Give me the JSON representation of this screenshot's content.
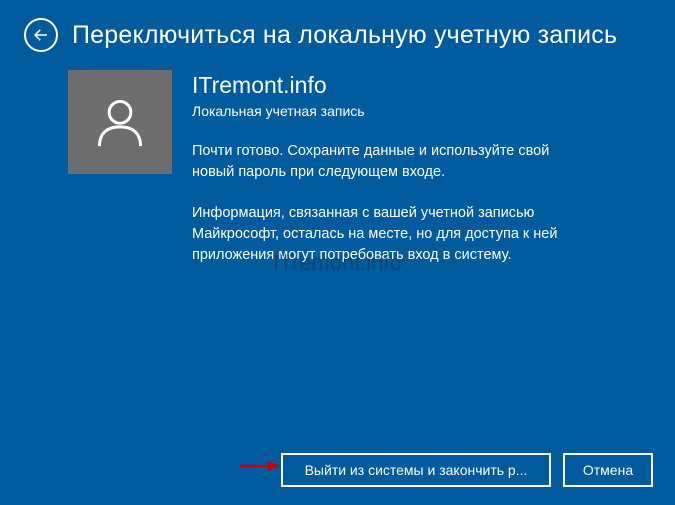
{
  "header": {
    "title": "Переключиться на локальную учетную запись"
  },
  "account": {
    "username": "ITremont.info",
    "type_label": "Локальная учетная запись"
  },
  "body": {
    "paragraph1": "Почти готово. Сохраните данные и используйте свой новый пароль при следующем входе.",
    "paragraph2": "Информация, связанная с вашей учетной записью Майкрософт, осталась на месте, но для доступа к ней приложения могут потребовать вход в систему."
  },
  "watermark": "ITremont.info",
  "footer": {
    "primary_label": "Выйти из системы и закончить р...",
    "cancel_label": "Отмена"
  }
}
